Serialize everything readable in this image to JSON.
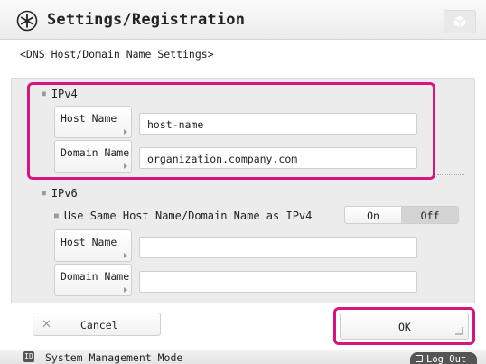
{
  "header": {
    "title": "Settings/Registration",
    "icon": "settings-asterisk-icon",
    "right_button_icon": "cube-icon"
  },
  "subtitle": "<DNS Host/Domain Name Settings>",
  "ipv4": {
    "section_label": "IPv4",
    "host_label": "Host Name",
    "host_value": "host-name",
    "domain_label": "Domain Name",
    "domain_value": "organization.company.com"
  },
  "ipv6": {
    "section_label": "IPv6",
    "same_label": "Use Same Host Name/Domain Name as IPv4",
    "toggle": {
      "on": "On",
      "off": "Off",
      "selected": "Off"
    },
    "host_label": "Host Name",
    "host_value": "",
    "domain_label": "Domain Name",
    "domain_value": ""
  },
  "buttons": {
    "cancel": "Cancel",
    "ok": "OK"
  },
  "footer": {
    "mode_icon": "ID",
    "mode": "System Management Mode",
    "logout": "Log Out"
  },
  "colors": {
    "highlight": "#d6167e",
    "panel": "#ececec",
    "toggle_selected": "#d4d4d4",
    "footer_button": "#555555"
  }
}
